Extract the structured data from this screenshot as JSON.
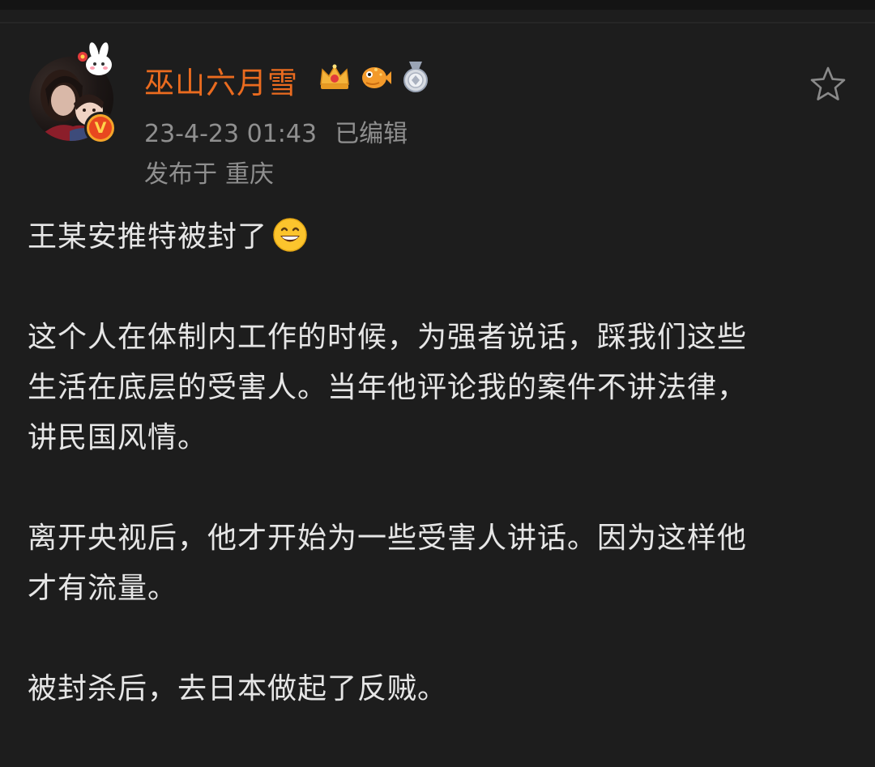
{
  "post": {
    "author": {
      "name": "巫山六月雪",
      "badges": [
        "crown-badge-icon",
        "fish-badge-icon",
        "medal-badge-icon"
      ],
      "verified": true
    },
    "time": "23-4-23 01:43",
    "edited_label": "已编辑",
    "location_prefix": "发布于",
    "location": "重庆",
    "paragraphs": [
      {
        "lines": [
          "王某安推特被封了"
        ],
        "trailing_emoji": "grinning-face-icon"
      },
      {
        "lines": [
          "这个人在体制内工作的时候，为强者说话，踩我们这些",
          "生活在底层的受害人。当年他评论我的案件不讲法律，",
          "讲民国风情。"
        ]
      },
      {
        "lines": [
          "离开央视后，他才开始为一些受害人讲话。因为这样他",
          "才有流量。"
        ]
      },
      {
        "lines": [
          "被封杀后，去日本做起了反贼。"
        ]
      }
    ]
  },
  "colors": {
    "background": "#1d1d1d",
    "username": "#ea6b1f",
    "meta_text": "#8f8f8f",
    "body_text": "#e6e6e6"
  }
}
